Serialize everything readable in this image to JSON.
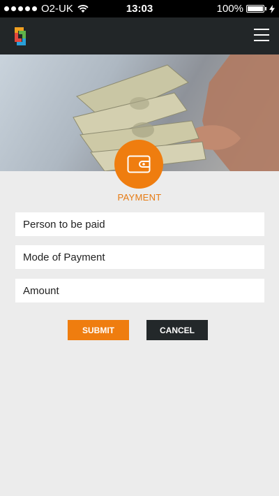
{
  "status_bar": {
    "carrier": "O2-UK",
    "time": "13:03",
    "battery": "100%",
    "signal_bars": 5,
    "battery_level": 1.0
  },
  "app_bar": {
    "logo_icon": "app-logo-icon",
    "menu_icon": "hamburger-menu-icon"
  },
  "hero": {
    "image": "hand-holding-cash-photo"
  },
  "payment": {
    "icon": "wallet-icon",
    "label": "PAYMENT"
  },
  "form": {
    "person_placeholder": "Person to be paid",
    "mode_placeholder": "Mode of Payment",
    "amount_placeholder": "Amount",
    "submit_label": "SUBMIT",
    "cancel_label": "CANCEL"
  },
  "colors": {
    "accent": "#ef7d0f",
    "app_bar": "#222628",
    "cancel": "#23282a",
    "background": "#ececec"
  }
}
